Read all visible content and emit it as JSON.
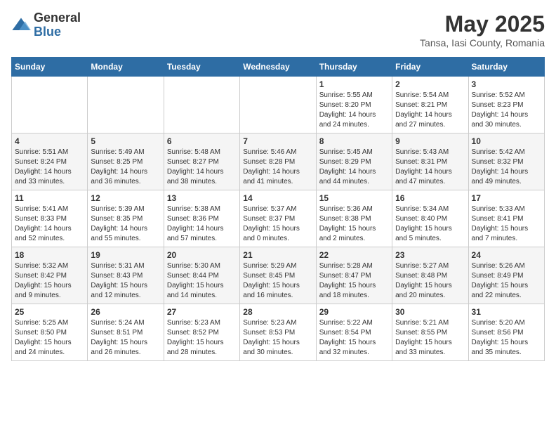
{
  "logo": {
    "general": "General",
    "blue": "Blue"
  },
  "title": "May 2025",
  "subtitle": "Tansa, Iasi County, Romania",
  "days_of_week": [
    "Sunday",
    "Monday",
    "Tuesday",
    "Wednesday",
    "Thursday",
    "Friday",
    "Saturday"
  ],
  "weeks": [
    [
      {
        "day": "",
        "info": ""
      },
      {
        "day": "",
        "info": ""
      },
      {
        "day": "",
        "info": ""
      },
      {
        "day": "",
        "info": ""
      },
      {
        "day": "1",
        "info": "Sunrise: 5:55 AM\nSunset: 8:20 PM\nDaylight: 14 hours\nand 24 minutes."
      },
      {
        "day": "2",
        "info": "Sunrise: 5:54 AM\nSunset: 8:21 PM\nDaylight: 14 hours\nand 27 minutes."
      },
      {
        "day": "3",
        "info": "Sunrise: 5:52 AM\nSunset: 8:23 PM\nDaylight: 14 hours\nand 30 minutes."
      }
    ],
    [
      {
        "day": "4",
        "info": "Sunrise: 5:51 AM\nSunset: 8:24 PM\nDaylight: 14 hours\nand 33 minutes."
      },
      {
        "day": "5",
        "info": "Sunrise: 5:49 AM\nSunset: 8:25 PM\nDaylight: 14 hours\nand 36 minutes."
      },
      {
        "day": "6",
        "info": "Sunrise: 5:48 AM\nSunset: 8:27 PM\nDaylight: 14 hours\nand 38 minutes."
      },
      {
        "day": "7",
        "info": "Sunrise: 5:46 AM\nSunset: 8:28 PM\nDaylight: 14 hours\nand 41 minutes."
      },
      {
        "day": "8",
        "info": "Sunrise: 5:45 AM\nSunset: 8:29 PM\nDaylight: 14 hours\nand 44 minutes."
      },
      {
        "day": "9",
        "info": "Sunrise: 5:43 AM\nSunset: 8:31 PM\nDaylight: 14 hours\nand 47 minutes."
      },
      {
        "day": "10",
        "info": "Sunrise: 5:42 AM\nSunset: 8:32 PM\nDaylight: 14 hours\nand 49 minutes."
      }
    ],
    [
      {
        "day": "11",
        "info": "Sunrise: 5:41 AM\nSunset: 8:33 PM\nDaylight: 14 hours\nand 52 minutes."
      },
      {
        "day": "12",
        "info": "Sunrise: 5:39 AM\nSunset: 8:35 PM\nDaylight: 14 hours\nand 55 minutes."
      },
      {
        "day": "13",
        "info": "Sunrise: 5:38 AM\nSunset: 8:36 PM\nDaylight: 14 hours\nand 57 minutes."
      },
      {
        "day": "14",
        "info": "Sunrise: 5:37 AM\nSunset: 8:37 PM\nDaylight: 15 hours\nand 0 minutes."
      },
      {
        "day": "15",
        "info": "Sunrise: 5:36 AM\nSunset: 8:38 PM\nDaylight: 15 hours\nand 2 minutes."
      },
      {
        "day": "16",
        "info": "Sunrise: 5:34 AM\nSunset: 8:40 PM\nDaylight: 15 hours\nand 5 minutes."
      },
      {
        "day": "17",
        "info": "Sunrise: 5:33 AM\nSunset: 8:41 PM\nDaylight: 15 hours\nand 7 minutes."
      }
    ],
    [
      {
        "day": "18",
        "info": "Sunrise: 5:32 AM\nSunset: 8:42 PM\nDaylight: 15 hours\nand 9 minutes."
      },
      {
        "day": "19",
        "info": "Sunrise: 5:31 AM\nSunset: 8:43 PM\nDaylight: 15 hours\nand 12 minutes."
      },
      {
        "day": "20",
        "info": "Sunrise: 5:30 AM\nSunset: 8:44 PM\nDaylight: 15 hours\nand 14 minutes."
      },
      {
        "day": "21",
        "info": "Sunrise: 5:29 AM\nSunset: 8:45 PM\nDaylight: 15 hours\nand 16 minutes."
      },
      {
        "day": "22",
        "info": "Sunrise: 5:28 AM\nSunset: 8:47 PM\nDaylight: 15 hours\nand 18 minutes."
      },
      {
        "day": "23",
        "info": "Sunrise: 5:27 AM\nSunset: 8:48 PM\nDaylight: 15 hours\nand 20 minutes."
      },
      {
        "day": "24",
        "info": "Sunrise: 5:26 AM\nSunset: 8:49 PM\nDaylight: 15 hours\nand 22 minutes."
      }
    ],
    [
      {
        "day": "25",
        "info": "Sunrise: 5:25 AM\nSunset: 8:50 PM\nDaylight: 15 hours\nand 24 minutes."
      },
      {
        "day": "26",
        "info": "Sunrise: 5:24 AM\nSunset: 8:51 PM\nDaylight: 15 hours\nand 26 minutes."
      },
      {
        "day": "27",
        "info": "Sunrise: 5:23 AM\nSunset: 8:52 PM\nDaylight: 15 hours\nand 28 minutes."
      },
      {
        "day": "28",
        "info": "Sunrise: 5:23 AM\nSunset: 8:53 PM\nDaylight: 15 hours\nand 30 minutes."
      },
      {
        "day": "29",
        "info": "Sunrise: 5:22 AM\nSunset: 8:54 PM\nDaylight: 15 hours\nand 32 minutes."
      },
      {
        "day": "30",
        "info": "Sunrise: 5:21 AM\nSunset: 8:55 PM\nDaylight: 15 hours\nand 33 minutes."
      },
      {
        "day": "31",
        "info": "Sunrise: 5:20 AM\nSunset: 8:56 PM\nDaylight: 15 hours\nand 35 minutes."
      }
    ]
  ]
}
